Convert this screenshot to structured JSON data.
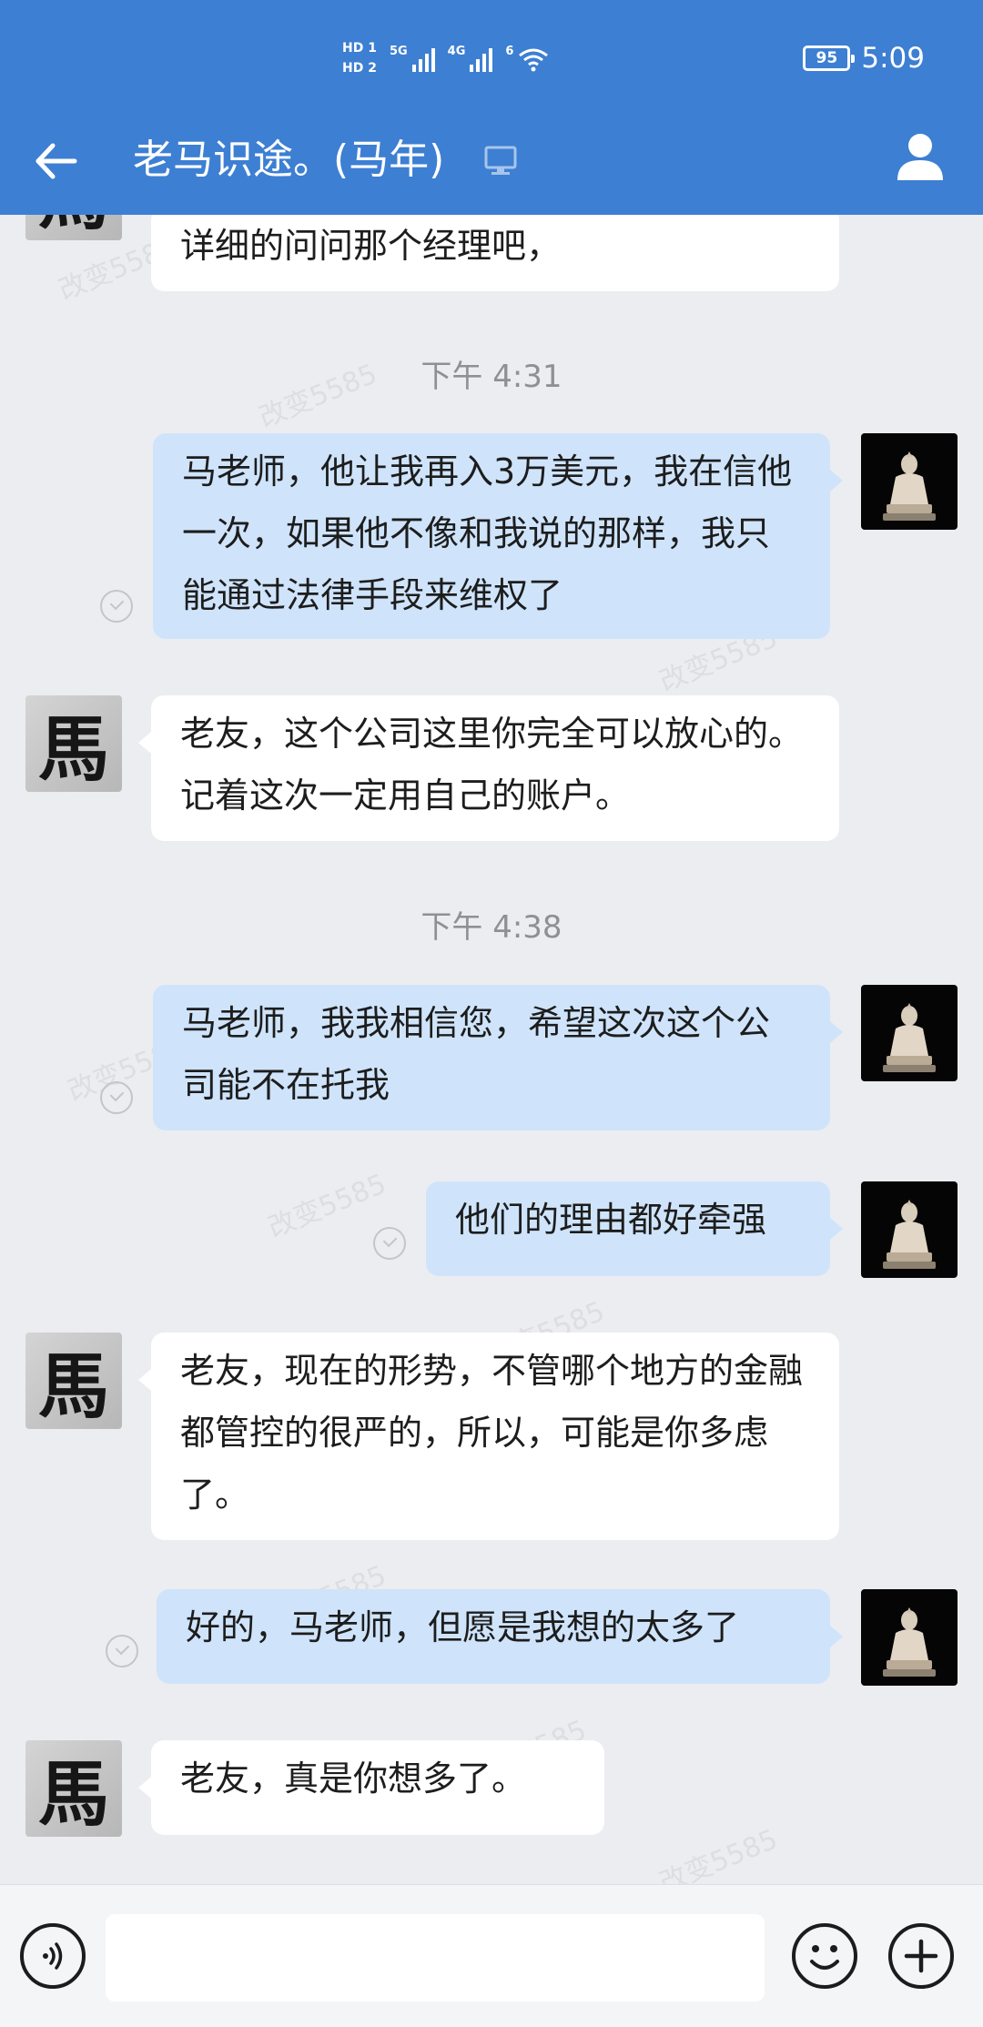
{
  "status_bar": {
    "hd1": "HD 1",
    "hd2": "HD 2",
    "sim1_tech": "5G",
    "sim2_tech": "4G",
    "wifi_tech": "6",
    "battery": "95",
    "time": "5:09"
  },
  "header": {
    "title": "老马识途。(马年)"
  },
  "messages": [
    {
      "sender": "contact",
      "text": "详细的问问那个经理吧，"
    },
    {
      "type": "timestamp",
      "text": "下午 4:31"
    },
    {
      "sender": "me",
      "text": "马老师，他让我再入3万美元，我在信他一次，如果他不像和我说的那样，我只能通过法律手段来维权了"
    },
    {
      "sender": "contact",
      "text": "老友，这个公司这里你完全可以放心的。记着这次一定用自己的账户。"
    },
    {
      "type": "timestamp",
      "text": "下午 4:38"
    },
    {
      "sender": "me",
      "text": "马老师，我我相信您，希望这次这个公司能不在托我"
    },
    {
      "sender": "me",
      "text": "他们的理由都好牵强"
    },
    {
      "sender": "contact",
      "text": "老友，现在的形势，不管哪个地方的金融都管控的很严的，所以，可能是你多虑了。"
    },
    {
      "sender": "me",
      "text": "好的，马老师，但愿是我想的太多了"
    },
    {
      "sender": "contact",
      "text": "老友，真是你想多了。"
    }
  ],
  "contact_avatar_glyph": "馬",
  "watermark_text": "改变5585",
  "input": {
    "placeholder": ""
  },
  "colors": {
    "header": "#3d7fd2",
    "chat_bg": "#ecedf1",
    "incoming_bubble": "#ffffff",
    "outgoing_bubble": "#cfe4fb"
  },
  "icons": [
    "back-arrow-icon",
    "device-icon",
    "profile-icon",
    "voice-icon",
    "emoji-icon",
    "plus-icon",
    "read-check-icon"
  ]
}
